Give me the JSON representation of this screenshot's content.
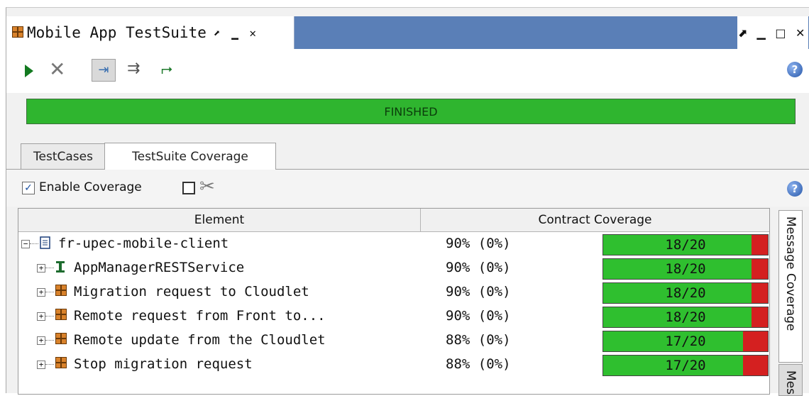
{
  "view": {
    "title": "Mobile App TestSuite",
    "title_icon": "grid-icon",
    "tab_controls": "⬈ ▁ ✕",
    "window_controls": "⬈ ▁ □ ✕"
  },
  "toolbar": {
    "run_icon": "play-icon",
    "stop_icon": "cancel-icon",
    "sequential_icon": "sequential-icon",
    "parallel_icon": "parallel-icon",
    "new_icon": "new-testcase-icon",
    "help_icon": "help-icon"
  },
  "progress": {
    "label": "FINISHED",
    "value": 1.0,
    "color": "#2fb52f"
  },
  "tabs": [
    {
      "label": "TestCases",
      "active": false
    },
    {
      "label": "TestSuite Coverage",
      "active": true
    }
  ],
  "coverage_bar": {
    "enable_label": "Enable Coverage",
    "enable_checked": true
  },
  "table": {
    "columns": [
      "Element",
      "Contract Coverage"
    ],
    "rows": [
      {
        "name": "fr-upec-mobile-client",
        "icon": "project-icon",
        "depth": 0,
        "expander": "⊟",
        "pct": "90% (0%)",
        "bar": "18/20",
        "fraction": 0.9
      },
      {
        "name": "AppManagerRESTService",
        "icon": "interface-icon",
        "depth": 1,
        "expander": "⊞",
        "pct": "90% (0%)",
        "bar": "18/20",
        "fraction": 0.9
      },
      {
        "name": "Migration request to Cloudlet",
        "icon": "testsuite-icon",
        "depth": 1,
        "expander": "⊞",
        "pct": "90% (0%)",
        "bar": "18/20",
        "fraction": 0.9
      },
      {
        "name": "Remote request from Front to...",
        "icon": "testsuite-icon",
        "depth": 1,
        "expander": "⊞",
        "pct": "90% (0%)",
        "bar": "18/20",
        "fraction": 0.9
      },
      {
        "name": "Remote update from the Cloudlet",
        "icon": "testsuite-icon",
        "depth": 1,
        "expander": "⊞",
        "pct": "88% (0%)",
        "bar": "17/20",
        "fraction": 0.85
      },
      {
        "name": "Stop migration request",
        "icon": "testsuite-icon",
        "depth": 1,
        "expander": "⊞",
        "pct": "88% (0%)",
        "bar": "17/20",
        "fraction": 0.85
      }
    ]
  },
  "side_tabs": [
    {
      "label": "Message Coverage"
    },
    {
      "label": "Mess"
    }
  ],
  "colors": {
    "covered": "#2fbf2f",
    "uncovered": "#d42020",
    "view_tab_bar": "#5a7fb7"
  }
}
